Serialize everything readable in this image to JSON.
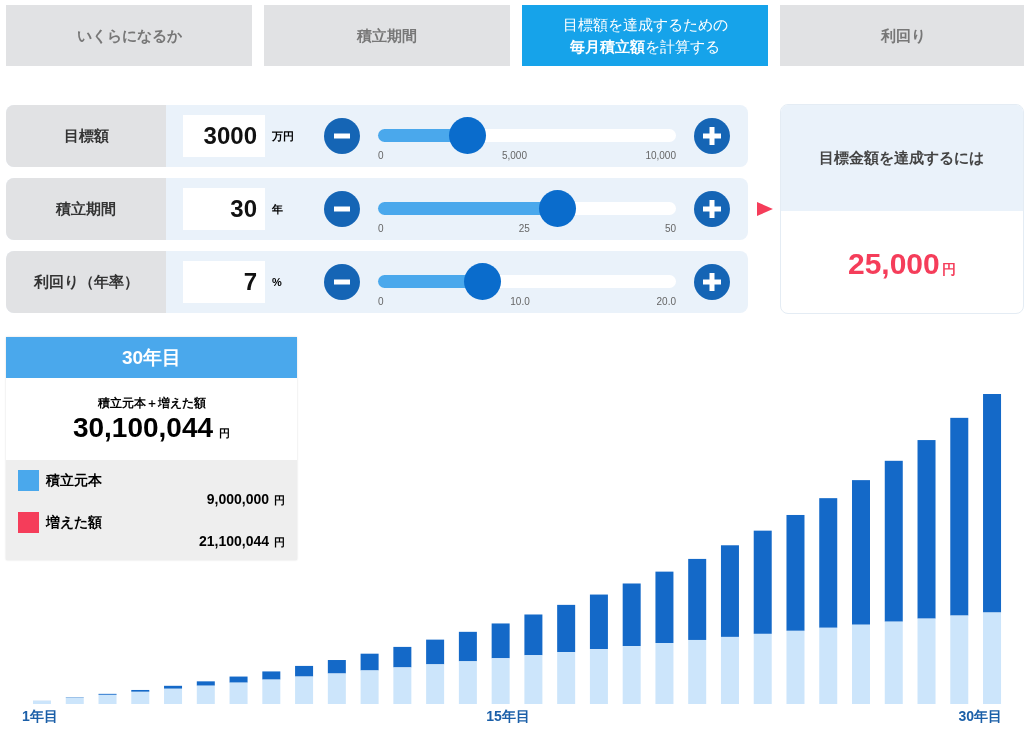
{
  "tabs": [
    {
      "lines": [
        "いくらになるか"
      ],
      "selected": false
    },
    {
      "lines": [
        "積立期間"
      ],
      "selected": false
    },
    {
      "lines": [
        "目標額を達成するための",
        "**毎月積立額**を計算する"
      ],
      "selected": true
    },
    {
      "lines": [
        "利回り"
      ],
      "selected": false
    }
  ],
  "inputs": [
    {
      "label": "目標額",
      "value": "3000",
      "unit": "万円",
      "level": 0.3,
      "ticks": [
        "0",
        "5,000",
        "10,000"
      ]
    },
    {
      "label": "積立期間",
      "value": "30",
      "unit": "年",
      "level": 0.6,
      "ticks": [
        "0",
        "25",
        "50"
      ]
    },
    {
      "label": "利回り（年率）",
      "value": "7",
      "unit": "%",
      "level": 0.35,
      "ticks": [
        "0",
        "10.0",
        "20.0"
      ]
    }
  ],
  "result": {
    "title": "目標金額を達成するには",
    "amount": "25,000",
    "unit": "円"
  },
  "summary": {
    "title": "30年目",
    "total_label": "積立元本＋増えた額",
    "total": "30,100,044",
    "unit": "円",
    "legend": [
      {
        "label": "積立元本",
        "value": "9,000,000",
        "unit": "円",
        "color": "#4aa8ec"
      },
      {
        "label": "増えた額",
        "value": "21,100,044",
        "unit": "円",
        "color": "#f53d5a"
      }
    ]
  },
  "chart": {
    "x_labels": [
      "1年目",
      "15年目",
      "30年目"
    ]
  }
}
